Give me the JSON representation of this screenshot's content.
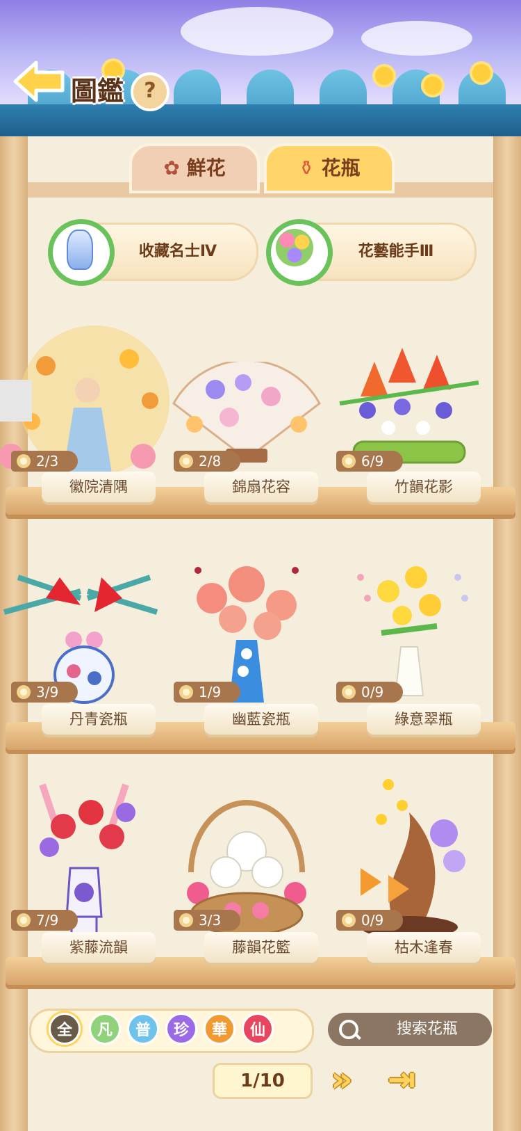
{
  "header": {
    "title": "圖鑑",
    "help": "?"
  },
  "tabs": [
    {
      "label": "鮮花",
      "active": false
    },
    {
      "label": "花瓶",
      "active": true
    }
  ],
  "achievements": [
    {
      "label": "收藏名士Ⅳ",
      "icon": "vase-icon"
    },
    {
      "label": "花藝能手Ⅲ",
      "icon": "bouquet-icon"
    }
  ],
  "vases": [
    {
      "name": "徽院清隅",
      "count": "2/3"
    },
    {
      "name": "錦扇花容",
      "count": "2/8"
    },
    {
      "name": "竹韻花影",
      "count": "6/9"
    },
    {
      "name": "丹青瓷瓶",
      "count": "3/9"
    },
    {
      "name": "幽藍瓷瓶",
      "count": "1/9"
    },
    {
      "name": "綠意翠瓶",
      "count": "0/9"
    },
    {
      "name": "紫藤流韻",
      "count": "7/9"
    },
    {
      "name": "藤韻花籃",
      "count": "3/3"
    },
    {
      "name": "枯木逢春",
      "count": "0/9"
    }
  ],
  "filters": [
    {
      "label": "全",
      "color": "#6a5a48",
      "selected": true
    },
    {
      "label": "凡",
      "color": "#8fd27a"
    },
    {
      "label": "普",
      "color": "#6fc3ea"
    },
    {
      "label": "珍",
      "color": "#9b6ae6"
    },
    {
      "label": "華",
      "color": "#f29a32"
    },
    {
      "label": "仙",
      "color": "#e8455e"
    }
  ],
  "search": {
    "placeholder": "搜索花瓶"
  },
  "pagination": {
    "page": "1/10"
  }
}
